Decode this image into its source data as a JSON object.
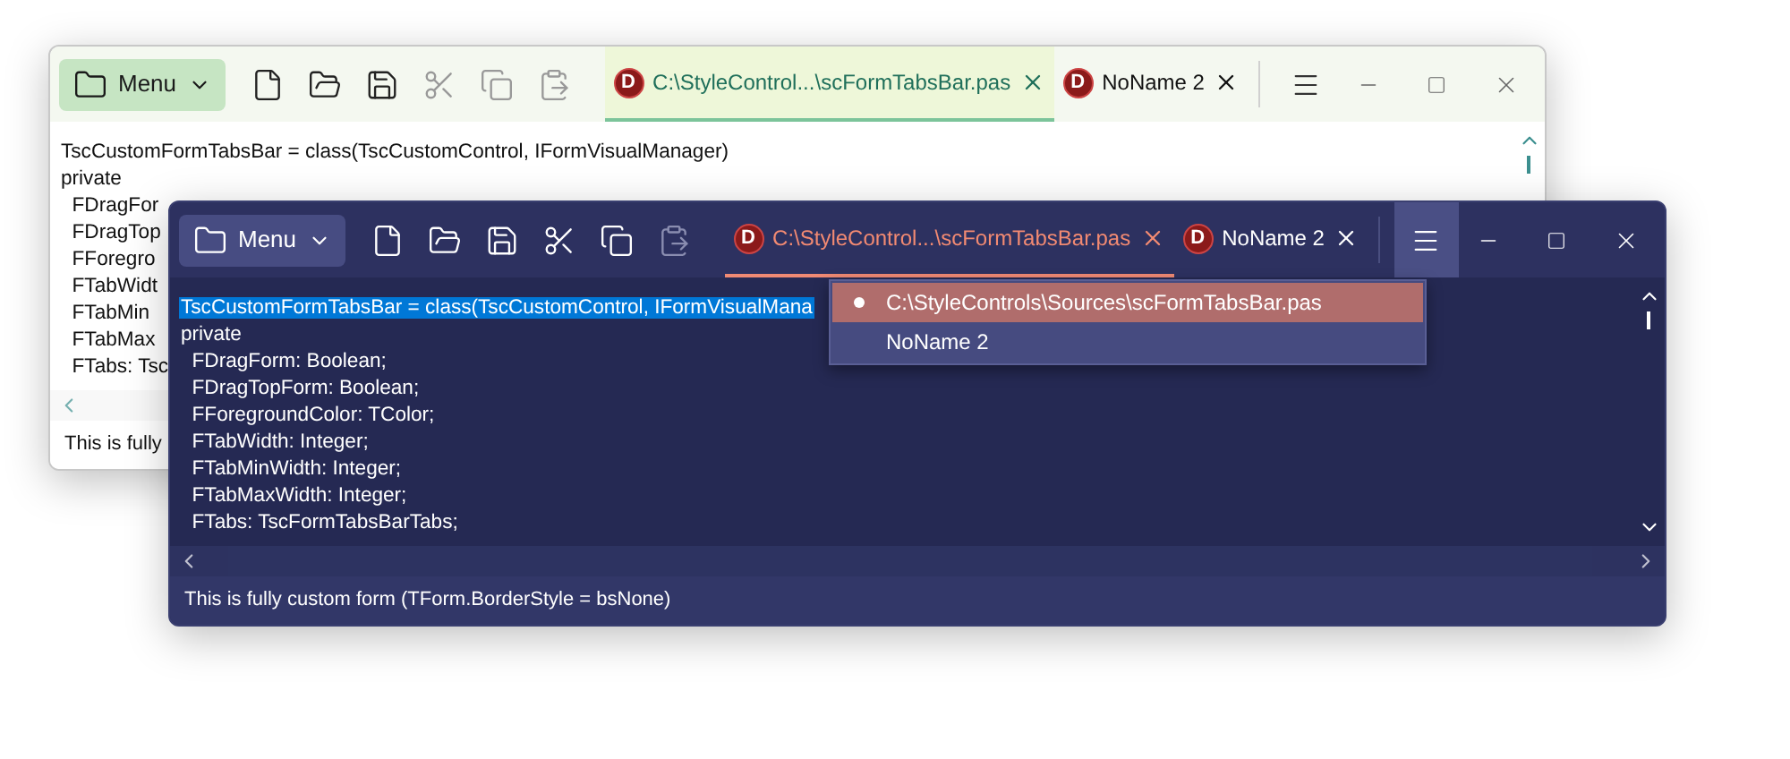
{
  "windows": [
    {
      "menu_open": false,
      "menu_button": {
        "label": "Menu"
      },
      "toolbar": [
        {
          "kind": "new",
          "disabled": false
        },
        {
          "kind": "open",
          "disabled": false
        },
        {
          "kind": "save",
          "disabled": false
        },
        {
          "kind": "cut",
          "disabled": true
        },
        {
          "kind": "copy",
          "disabled": true
        },
        {
          "kind": "paste",
          "disabled": true
        }
      ],
      "tabs": [
        {
          "badge": "D",
          "title": "C:\\StyleControl...\\scFormTabsBar.pas",
          "selected": true
        },
        {
          "badge": "D",
          "title": "NoName 2",
          "selected": false
        }
      ],
      "code_lines": [
        {
          "text": "TscCustomFormTabsBar = class(TscCustomControl, IFormVisualManager)",
          "selected": false
        },
        {
          "text": "private",
          "selected": false
        },
        {
          "text": "  FDragFor",
          "selected": false
        },
        {
          "text": "  FDragTop",
          "selected": false
        },
        {
          "text": "  FForegro",
          "selected": false
        },
        {
          "text": "  FTabWidt",
          "selected": false
        },
        {
          "text": "  FTabMin",
          "selected": false
        },
        {
          "text": "  FTabMax",
          "selected": false
        },
        {
          "text": "  FTabs: Tsc",
          "selected": false
        }
      ],
      "status": "This is fully"
    },
    {
      "menu_open": true,
      "menu_button": {
        "label": "Menu"
      },
      "toolbar": [
        {
          "kind": "new",
          "disabled": false
        },
        {
          "kind": "open",
          "disabled": false
        },
        {
          "kind": "save",
          "disabled": false
        },
        {
          "kind": "cut",
          "disabled": false
        },
        {
          "kind": "copy",
          "disabled": false
        },
        {
          "kind": "paste",
          "disabled": true
        }
      ],
      "tabs": [
        {
          "badge": "D",
          "title": "C:\\StyleControl...\\scFormTabsBar.pas",
          "selected": true
        },
        {
          "badge": "D",
          "title": "NoName 2",
          "selected": false
        }
      ],
      "tab_menu": [
        {
          "label": "C:\\StyleControls\\Sources\\scFormTabsBar.pas",
          "selected": true
        },
        {
          "label": "NoName 2",
          "selected": false
        }
      ],
      "code_lines": [
        {
          "text": "TscCustomFormTabsBar = class(TscCustomControl, IFormVisualMana",
          "selected": true
        },
        {
          "text": "private",
          "selected": false
        },
        {
          "text": "  FDragForm: Boolean;",
          "selected": false
        },
        {
          "text": "  FDragTopForm: Boolean;",
          "selected": false
        },
        {
          "text": "  FForegroundColor: TColor;",
          "selected": false
        },
        {
          "text": "  FTabWidth: Integer;",
          "selected": false
        },
        {
          "text": "  FTabMinWidth: Integer;",
          "selected": false
        },
        {
          "text": "  FTabMaxWidth: Integer;",
          "selected": false
        },
        {
          "text": "  FTabs: TscFormTabsBarTabs;",
          "selected": false
        }
      ],
      "status": "This is fully custom form (TForm.BorderStyle = bsNone)"
    }
  ]
}
